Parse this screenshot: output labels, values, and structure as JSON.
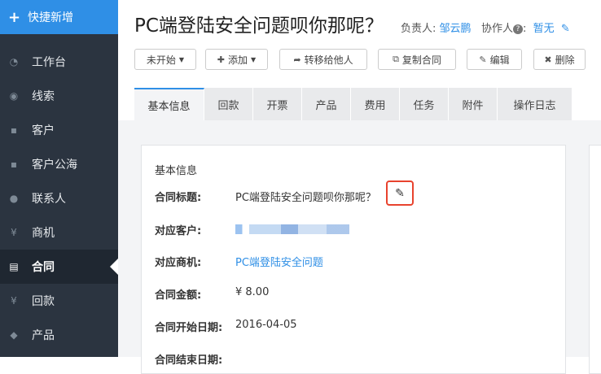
{
  "sidebar": {
    "quick_add": "快捷新增",
    "items": [
      {
        "label": "工作台",
        "icon": "dashboard-icon",
        "glyph": "◔"
      },
      {
        "label": "线索",
        "icon": "globe-icon",
        "glyph": "◉"
      },
      {
        "label": "客户",
        "icon": "users-icon",
        "glyph": "▪"
      },
      {
        "label": "客户公海",
        "icon": "users-icon",
        "glyph": "▪"
      },
      {
        "label": "联系人",
        "icon": "chat-icon",
        "glyph": "●"
      },
      {
        "label": "商机",
        "icon": "yen-icon",
        "glyph": "¥"
      },
      {
        "label": "合同",
        "icon": "document-icon",
        "glyph": "▤"
      },
      {
        "label": "回款",
        "icon": "yen-icon",
        "glyph": "¥"
      },
      {
        "label": "产品",
        "icon": "tag-icon",
        "glyph": "◆"
      }
    ],
    "active_index": 6
  },
  "header": {
    "title": "PC端登陆安全问题呗你那呢？",
    "owner_label": "负责人:",
    "owner": "邹云鹏",
    "collab_label": "协作人",
    "collab_value": "暂无"
  },
  "toolbar": {
    "status": "未开始",
    "add": "添加",
    "transfer": "转移给他人",
    "copy": "复制合同",
    "edit": "编辑",
    "delete": "删除"
  },
  "tabs": [
    "基本信息",
    "回款",
    "开票",
    "产品",
    "费用",
    "任务",
    "附件",
    "操作日志"
  ],
  "panel": {
    "title": "基本信息",
    "fields": [
      {
        "label": "合同标题:",
        "value": "PC端登陆安全问题呗你那呢？"
      },
      {
        "label": "对应客户:",
        "value": ""
      },
      {
        "label": "对应商机:",
        "value": "PC端登陆安全问题"
      },
      {
        "label": "合同金额:",
        "value": "¥ 8.00"
      },
      {
        "label": "合同开始日期:",
        "value": "2016-04-05"
      },
      {
        "label": "合同结束日期:",
        "value": ""
      }
    ]
  },
  "colors": {
    "accent": "#2f8fe6",
    "sidebar": "#2b3440",
    "highlight": "#e8432e"
  }
}
